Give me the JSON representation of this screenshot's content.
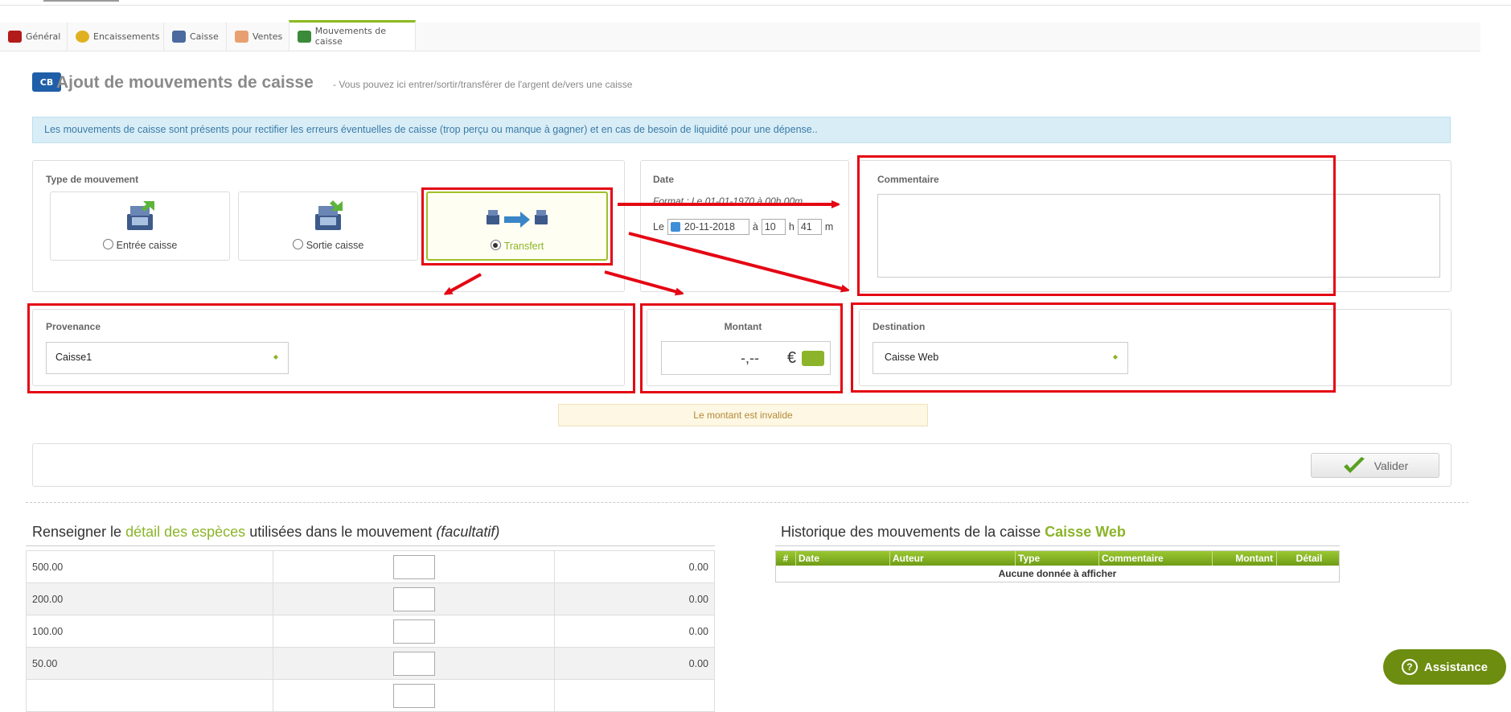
{
  "tabs": [
    {
      "label": "Général",
      "icon": "wallet-icon",
      "color": "#b31b1b"
    },
    {
      "label": "Encaissements",
      "icon": "coins-icon",
      "color": "#e0b020"
    },
    {
      "label": "Caisse",
      "icon": "register-icon",
      "color": "#4a6aa0"
    },
    {
      "label": "Ventes",
      "icon": "handshake-icon",
      "color": "#e8a070"
    },
    {
      "label": "Mouvements de caisse",
      "icon": "cash-movement-icon",
      "color": "#3a8a3a",
      "active": true
    }
  ],
  "header": {
    "badge": "CB",
    "title": "Ajout de mouvements de caisse",
    "subtitle": "- Vous pouvez ici entrer/sortir/transférer de l'argent de/vers une caisse"
  },
  "info_message": "Les mouvements de caisse sont présents pour rectifier les erreurs éventuelles de caisse (trop perçu ou manque à gagner) et en cas de besoin de liquidité pour une dépense..",
  "movement_type": {
    "label": "Type de mouvement",
    "options": [
      {
        "label": "Entrée caisse",
        "selected": false
      },
      {
        "label": "Sortie caisse",
        "selected": false
      },
      {
        "label": "Transfert",
        "selected": true
      }
    ]
  },
  "date": {
    "label": "Date",
    "format_hint": "Format : Le 01-01-1970 à 00h 00m",
    "prefix": "Le",
    "value": "20-11-2018",
    "at": "à",
    "hour": "10",
    "h": "h",
    "minute": "41",
    "m": "m"
  },
  "comment": {
    "label": "Commentaire",
    "value": ""
  },
  "provenance": {
    "label": "Provenance",
    "value": "Caisse1"
  },
  "amount": {
    "label": "Montant",
    "value": "-,--",
    "currency": "€",
    "error": "Le montant est invalide"
  },
  "destination": {
    "label": "Destination",
    "value": "Caisse Web"
  },
  "validate_button": "Valider",
  "cash_detail": {
    "title_pre": "Renseigner le ",
    "title_highlight": "détail des espèces",
    "title_mid": " utilisées dans le mouvement ",
    "title_italic": "(facultatif)",
    "rows": [
      {
        "denomination": "500.00",
        "total": "0.00"
      },
      {
        "denomination": "200.00",
        "total": "0.00"
      },
      {
        "denomination": "100.00",
        "total": "0.00"
      },
      {
        "denomination": "50.00",
        "total": "0.00"
      },
      {
        "denomination": "",
        "total": ""
      }
    ]
  },
  "history": {
    "title_pre": "Historique des mouvements de la caisse ",
    "title_highlight": "Caisse Web",
    "columns": [
      "#",
      "Date",
      "Auteur",
      "Type",
      "Commentaire",
      "Montant",
      "Détail"
    ],
    "empty": "Aucune donnée à afficher"
  },
  "assistance": "Assistance",
  "colors": {
    "accent_green": "#8cb42a",
    "annotation_red": "#e40613",
    "info_bg": "#d9edf7"
  }
}
